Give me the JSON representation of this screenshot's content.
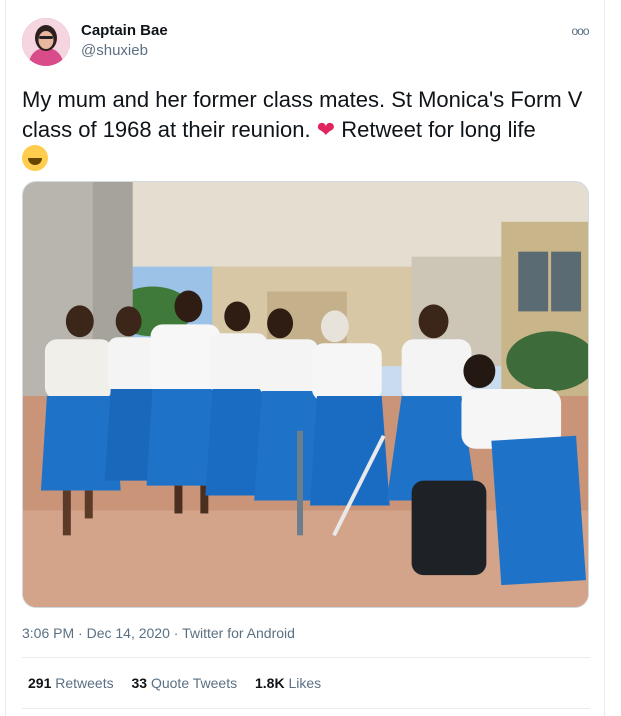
{
  "user": {
    "display_name": "Captain Bae",
    "handle": "@shuxieb"
  },
  "tweet": {
    "text_part1": "My mum and her former class mates.  St Monica's Form V class of 1968 at their reunion. ",
    "heart_emoji": "❤",
    "text_part2": " Retweet for long life",
    "more_icon": "ooo"
  },
  "meta": {
    "time": "3:06 PM",
    "separator1": " · ",
    "date": "Dec 14, 2020",
    "separator2": " · ",
    "client": "Twitter for Android"
  },
  "stats": {
    "retweets_count": "291",
    "retweets_label": " Retweets",
    "quotes_count": "33",
    "quotes_label": " Quote Tweets",
    "likes_count": "1.8K",
    "likes_label": " Likes"
  },
  "colors": {
    "skirt": "#1e73c8",
    "blouse": "#f4f4f4",
    "heart": "#e0245e",
    "muted": "#5b7083"
  }
}
